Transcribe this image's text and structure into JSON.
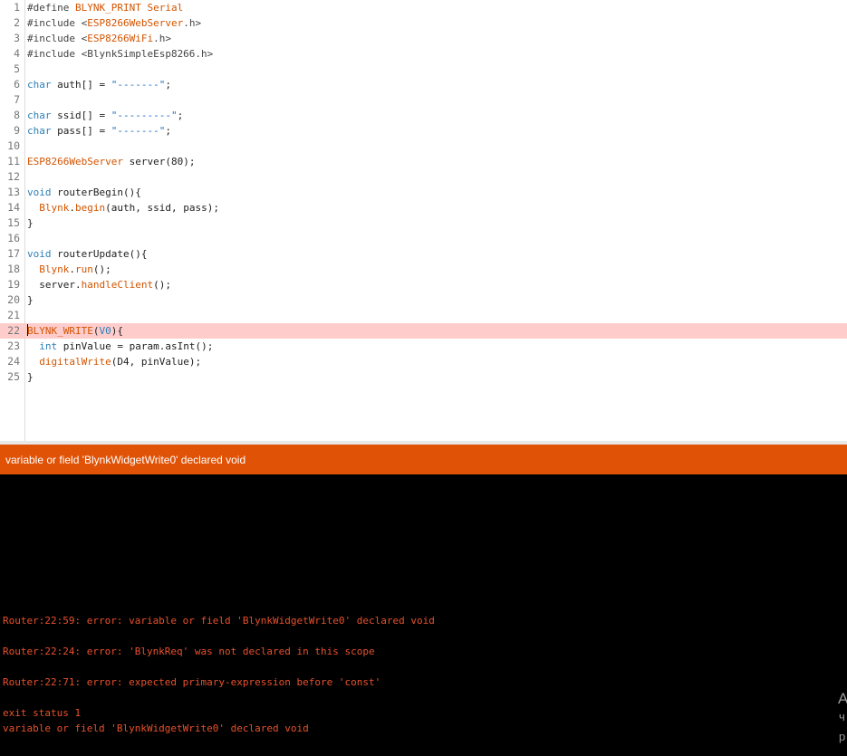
{
  "editor": {
    "highlighted_line": 22,
    "lines": [
      {
        "n": "1",
        "tokens": [
          {
            "t": "#define ",
            "c": "pre"
          },
          {
            "t": "BLYNK_PRINT Serial",
            "c": "cls"
          }
        ]
      },
      {
        "n": "2",
        "tokens": [
          {
            "t": "#include <",
            "c": "pre"
          },
          {
            "t": "ESP8266WebServer",
            "c": "cls"
          },
          {
            "t": ".h>",
            "c": "pre"
          }
        ]
      },
      {
        "n": "3",
        "tokens": [
          {
            "t": "#include <",
            "c": "pre"
          },
          {
            "t": "ESP8266WiFi",
            "c": "cls"
          },
          {
            "t": ".h>",
            "c": "pre"
          }
        ]
      },
      {
        "n": "4",
        "tokens": [
          {
            "t": "#include <BlynkSimpleEsp8266.h>",
            "c": "pre"
          }
        ]
      },
      {
        "n": "5",
        "tokens": []
      },
      {
        "n": "6",
        "tokens": [
          {
            "t": "char",
            "c": "kw"
          },
          {
            "t": " auth[] = ",
            "c": "plain"
          },
          {
            "t": "\"-------\"",
            "c": "str"
          },
          {
            "t": ";",
            "c": "plain"
          }
        ]
      },
      {
        "n": "7",
        "tokens": []
      },
      {
        "n": "8",
        "tokens": [
          {
            "t": "char",
            "c": "kw"
          },
          {
            "t": " ssid[] = ",
            "c": "plain"
          },
          {
            "t": "\"---------\"",
            "c": "str"
          },
          {
            "t": ";",
            "c": "plain"
          }
        ]
      },
      {
        "n": "9",
        "tokens": [
          {
            "t": "char",
            "c": "kw"
          },
          {
            "t": " pass[] = ",
            "c": "plain"
          },
          {
            "t": "\"-------\"",
            "c": "str"
          },
          {
            "t": ";",
            "c": "plain"
          }
        ]
      },
      {
        "n": "10",
        "tokens": []
      },
      {
        "n": "11",
        "tokens": [
          {
            "t": "ESP8266WebServer",
            "c": "cls"
          },
          {
            "t": " server(80);",
            "c": "plain"
          }
        ]
      },
      {
        "n": "12",
        "tokens": []
      },
      {
        "n": "13",
        "tokens": [
          {
            "t": "void",
            "c": "kw"
          },
          {
            "t": " routerBegin(){",
            "c": "plain"
          }
        ]
      },
      {
        "n": "14",
        "tokens": [
          {
            "t": "  ",
            "c": "plain"
          },
          {
            "t": "Blynk",
            "c": "cls"
          },
          {
            "t": ".",
            "c": "plain"
          },
          {
            "t": "begin",
            "c": "fn"
          },
          {
            "t": "(auth, ssid, pass);",
            "c": "plain"
          }
        ]
      },
      {
        "n": "15",
        "tokens": [
          {
            "t": "}",
            "c": "plain"
          }
        ]
      },
      {
        "n": "16",
        "tokens": []
      },
      {
        "n": "17",
        "tokens": [
          {
            "t": "void",
            "c": "kw"
          },
          {
            "t": " routerUpdate(){",
            "c": "plain"
          }
        ]
      },
      {
        "n": "18",
        "tokens": [
          {
            "t": "  ",
            "c": "plain"
          },
          {
            "t": "Blynk",
            "c": "cls"
          },
          {
            "t": ".",
            "c": "plain"
          },
          {
            "t": "run",
            "c": "fn"
          },
          {
            "t": "();",
            "c": "plain"
          }
        ]
      },
      {
        "n": "19",
        "tokens": [
          {
            "t": "  server.",
            "c": "plain"
          },
          {
            "t": "handleClient",
            "c": "fn"
          },
          {
            "t": "();",
            "c": "plain"
          }
        ]
      },
      {
        "n": "20",
        "tokens": [
          {
            "t": "}",
            "c": "plain"
          }
        ]
      },
      {
        "n": "21",
        "tokens": []
      },
      {
        "n": "22",
        "tokens": [
          {
            "t": "BLYNK_WRITE",
            "c": "cls"
          },
          {
            "t": "(",
            "c": "plain"
          },
          {
            "t": "V0",
            "c": "kw"
          },
          {
            "t": "){",
            "c": "plain"
          }
        ]
      },
      {
        "n": "23",
        "tokens": [
          {
            "t": "  ",
            "c": "plain"
          },
          {
            "t": "int",
            "c": "kw"
          },
          {
            "t": " pinValue = param.asInt();",
            "c": "plain"
          }
        ]
      },
      {
        "n": "24",
        "tokens": [
          {
            "t": "  ",
            "c": "plain"
          },
          {
            "t": "digitalWrite",
            "c": "fn"
          },
          {
            "t": "(D4, pinValue);",
            "c": "plain"
          }
        ]
      },
      {
        "n": "25",
        "tokens": [
          {
            "t": "}",
            "c": "plain"
          }
        ]
      }
    ]
  },
  "error_bar": {
    "message": "variable or field 'BlynkWidgetWrite0' declared void"
  },
  "console": {
    "lines": [
      "Router:22:59: error: variable or field 'BlynkWidgetWrite0' declared void",
      "Router:22:24: error: 'BlynkReq' was not declared in this scope",
      "Router:22:71: error: expected primary-expression before 'const'",
      "exit status 1",
      "variable or field 'BlynkWidgetWrite0' declared void"
    ]
  },
  "watermark": {
    "line1": "A",
    "line2": "ч",
    "line3": "р"
  },
  "colors": {
    "error_bar": "#e05206",
    "console_bg": "#000000",
    "console_text": "#e8512c",
    "highlight_line": "#ffcccc",
    "keyword": "#2d7fb8",
    "class": "#d35400"
  }
}
